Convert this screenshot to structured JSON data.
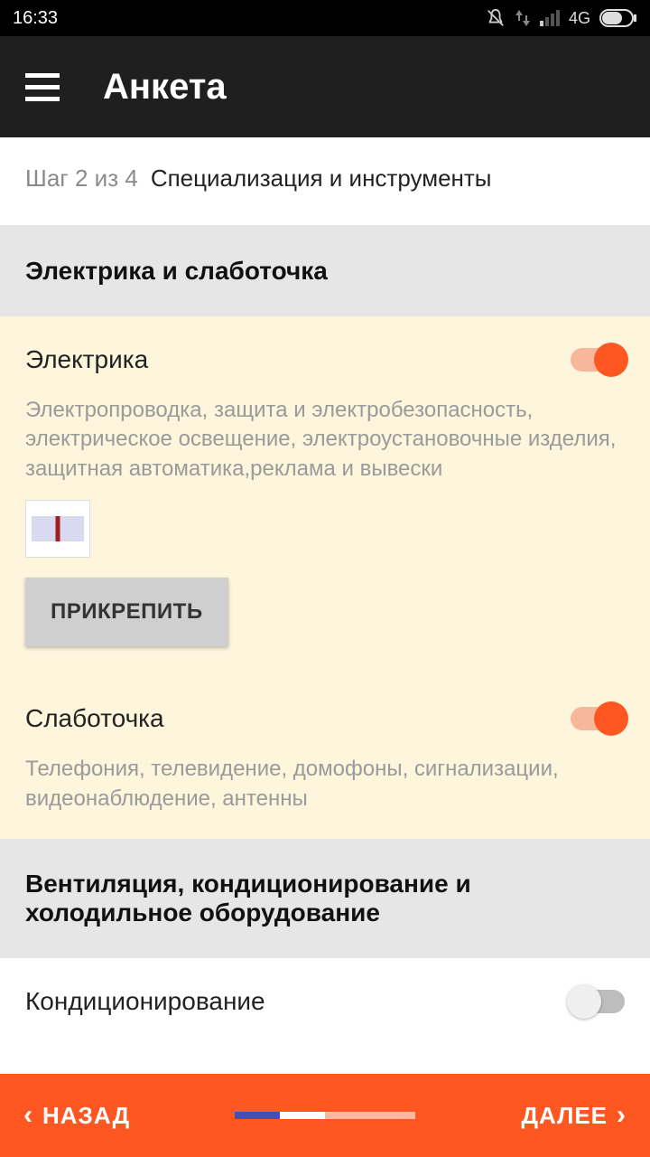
{
  "status": {
    "time": "16:33",
    "network": "4G"
  },
  "app": {
    "title": "Анкета"
  },
  "step": {
    "prefix": "Шаг 2 из 4",
    "title": "Специализация и инструменты"
  },
  "sections": {
    "electrical": {
      "header": "Электрика и слаботочка",
      "items": [
        {
          "title": "Электрика",
          "toggle": true,
          "desc": "Электропроводка, защита и электробезопасность, электрическое освещение, электроустановочные изделия, защитная автоматика,реклама и вывески",
          "attach_label": "ПРИКРЕПИТЬ"
        },
        {
          "title": "Слаботочка",
          "toggle": true,
          "desc": "Телефония, телевидение, домофоны, сигнализации, видеонаблюдение, антенны"
        }
      ]
    },
    "hvac": {
      "header": "Вентиляция, кондиционирование и холодильное оборудование",
      "items": [
        {
          "title": "Кондиционирование",
          "toggle": false
        }
      ]
    }
  },
  "footer": {
    "back": "НАЗАД",
    "next": "ДАЛЕЕ"
  }
}
